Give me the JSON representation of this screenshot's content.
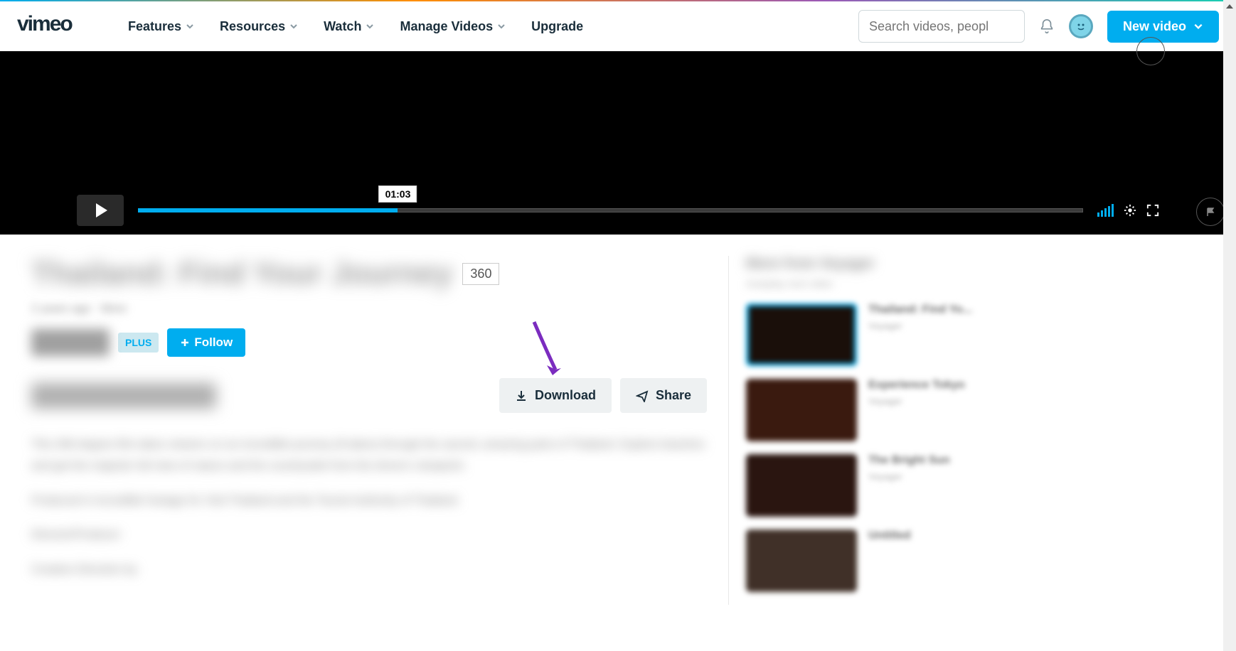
{
  "header": {
    "logo_text": "vimeo",
    "nav": [
      {
        "label": "Features"
      },
      {
        "label": "Resources"
      },
      {
        "label": "Watch"
      },
      {
        "label": "Manage Videos"
      },
      {
        "label": "Upgrade"
      }
    ],
    "search_placeholder": "Search videos, peopl",
    "new_video_label": "New video"
  },
  "player": {
    "time_tooltip": "01:03"
  },
  "video": {
    "title": "Thailand: Find Your Journey",
    "badge": "360",
    "meta": "2 years ago · More",
    "plus_label": "PLUS",
    "follow_label": "Follow",
    "download_label": "Download",
    "share_label": "Share",
    "description_p1": "This 360-degree film takes viewers on an incredible journey (8 takes) through the sacred, amazing parts of Thailand. Explore beaches and get the majestic full view of nature and the countryside from the drone's viewpoint.",
    "description_p2": "Produced in incredible footage for Visit Thailand and the Tourist Authority of Thailand.",
    "description_p3": "Director/Producer",
    "description_p4": "Creative Direction by"
  },
  "sidebar": {
    "title": "More from Voyager",
    "subtitle": "Autoplay next video",
    "items": [
      {
        "title": "Thailand: Find Yo...",
        "author": "Voyager"
      },
      {
        "title": "Experience Tokyo",
        "author": "Voyager"
      },
      {
        "title": "The Bright Sun",
        "author": "Voyager"
      },
      {
        "title": "Untitled",
        "author": ""
      }
    ]
  },
  "colors": {
    "primary": "#00adef",
    "text_dark": "#1a2e3b"
  }
}
